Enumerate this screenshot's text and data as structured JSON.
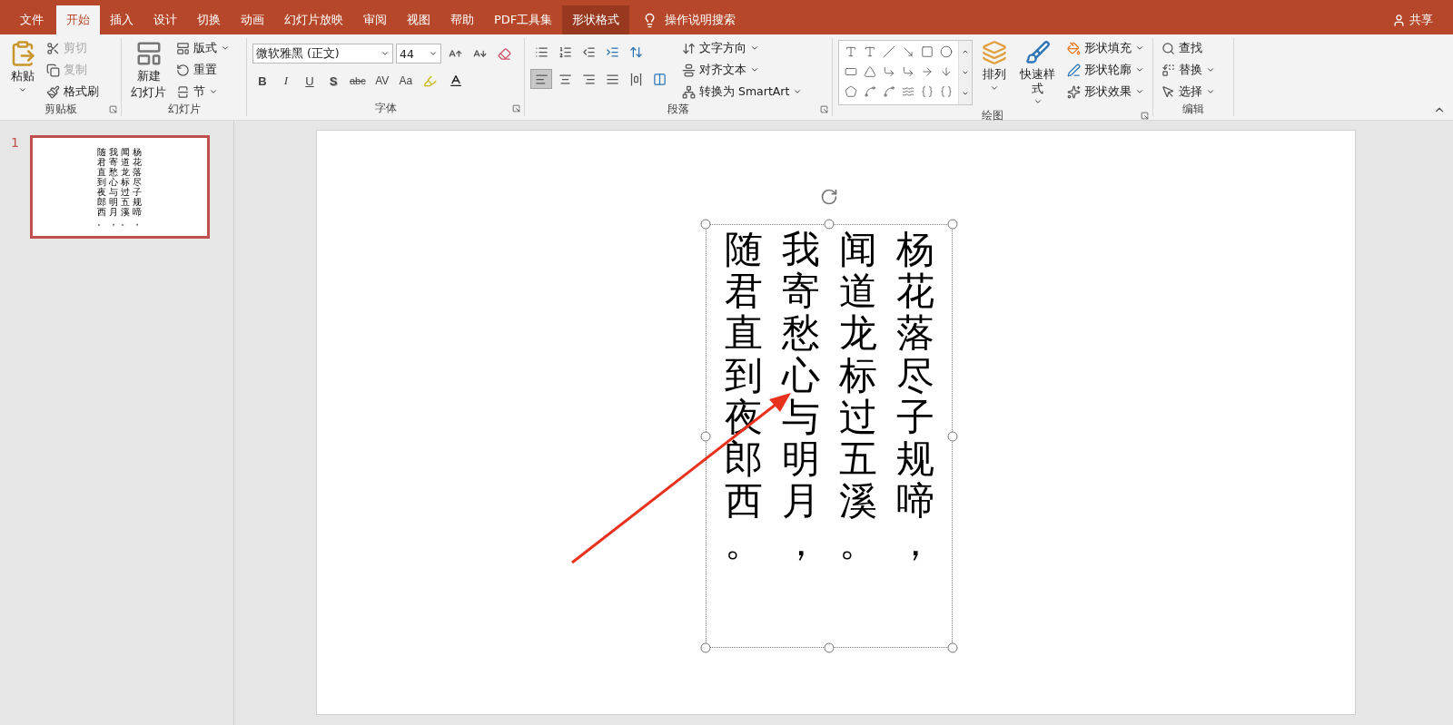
{
  "tabs": [
    {
      "label": "文件",
      "kind": "file",
      "selected": false
    },
    {
      "label": "开始",
      "kind": "normal",
      "selected": true
    },
    {
      "label": "插入",
      "kind": "normal",
      "selected": false
    },
    {
      "label": "设计",
      "kind": "normal",
      "selected": false
    },
    {
      "label": "切换",
      "kind": "normal",
      "selected": false
    },
    {
      "label": "动画",
      "kind": "normal",
      "selected": false
    },
    {
      "label": "幻灯片放映",
      "kind": "normal",
      "selected": false
    },
    {
      "label": "审阅",
      "kind": "normal",
      "selected": false
    },
    {
      "label": "视图",
      "kind": "normal",
      "selected": false
    },
    {
      "label": "帮助",
      "kind": "normal",
      "selected": false
    },
    {
      "label": "PDF工具集",
      "kind": "normal",
      "selected": false
    },
    {
      "label": "形状格式",
      "kind": "contextual",
      "selected": false
    }
  ],
  "tell_me": "操作说明搜索",
  "share": "共享",
  "clipboard": {
    "title": "剪贴板",
    "paste": "粘贴",
    "commands": [
      {
        "kind": "cut",
        "label": "剪切",
        "disabled": true
      },
      {
        "kind": "copy",
        "label": "复制",
        "disabled": true
      },
      {
        "kind": "painter",
        "label": "格式刷",
        "disabled": false
      }
    ]
  },
  "slides_group": {
    "title": "幻灯片",
    "new_slide": [
      "新建",
      "幻灯片"
    ],
    "commands": [
      {
        "kind": "layout",
        "label": "版式"
      },
      {
        "kind": "reset",
        "label": "重置"
      },
      {
        "kind": "section",
        "label": "节"
      }
    ]
  },
  "font": {
    "title": "字体",
    "font_name": "微软雅黑 (正文)",
    "font_size": "44",
    "styles": [
      {
        "kind": "bold",
        "label": "B"
      },
      {
        "kind": "italic",
        "label": "I"
      },
      {
        "kind": "underline",
        "label": "U"
      },
      {
        "kind": "shadow",
        "label": "S"
      },
      {
        "kind": "strike",
        "label": "abc"
      },
      {
        "kind": "spacing",
        "label": "AV"
      },
      {
        "kind": "case",
        "label": "Aa"
      }
    ]
  },
  "paragraph": {
    "title": "段落",
    "alignment": [
      {
        "kind": "left",
        "selected": true
      },
      {
        "kind": "center",
        "selected": false
      },
      {
        "kind": "right",
        "selected": false
      },
      {
        "kind": "justify",
        "selected": false
      },
      {
        "kind": "distributed",
        "selected": false
      }
    ],
    "commands": [
      {
        "kind": "direction",
        "label": "文字方向"
      },
      {
        "kind": "align",
        "label": "对齐文本"
      },
      {
        "kind": "smartart",
        "label": "转换为 SmartArt"
      }
    ]
  },
  "drawing": {
    "title": "绘图",
    "arrange": "排列",
    "quick_styles": "快速样式",
    "commands": [
      {
        "kind": "fill",
        "label": "形状填充"
      },
      {
        "kind": "outline",
        "label": "形状轮廓"
      },
      {
        "kind": "effects",
        "label": "形状效果"
      }
    ]
  },
  "editing": {
    "title": "编辑",
    "commands": [
      {
        "kind": "find",
        "label": "查找"
      },
      {
        "kind": "replace",
        "label": "替换"
      },
      {
        "kind": "select",
        "label": "选择"
      }
    ]
  },
  "thumbnails": [
    {
      "number": "1",
      "selected": true,
      "columns": [
        "随君直到夜郎西。",
        "我寄愁心与明月，",
        "闻道龙标过五溪。",
        "杨花落尽子规啼，"
      ]
    }
  ],
  "slide": {
    "text_box_selected": true,
    "columns": [
      "随君直到夜郎西。",
      "我寄愁心与明月，",
      "闻道龙标过五溪。",
      "杨花落尽子规啼，"
    ]
  }
}
